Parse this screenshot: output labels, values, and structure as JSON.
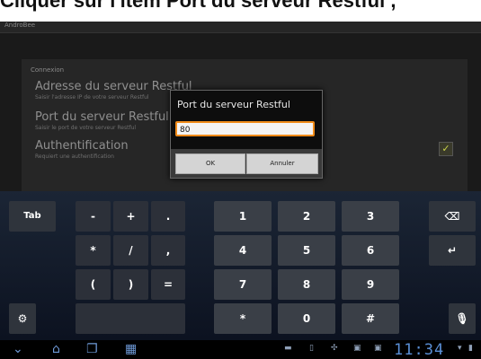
{
  "caption": "Cliquer sur l'item Port du serveur Restful ,",
  "app": {
    "title": "AndroBee"
  },
  "settings": {
    "section": "Connexion",
    "items": [
      {
        "title": "Adresse du serveur Restful",
        "summary": "Saisir l'adresse IP de votre serveur Restful"
      },
      {
        "title": "Port du serveur Restful",
        "summary": "Saisir le port de votre serveur Restful"
      },
      {
        "title": "Authentification",
        "summary": "Requiert une authentification",
        "checked": true
      }
    ]
  },
  "dialog": {
    "title": "Port du serveur Restful",
    "value": "80",
    "ok_label": "OK",
    "cancel_label": "Annuler"
  },
  "keyboard": {
    "tab": "Tab",
    "symbols": [
      "-",
      "+",
      ".",
      "*",
      "/",
      ",",
      "(",
      ")",
      "="
    ],
    "digits": [
      "1",
      "2",
      "3",
      "4",
      "5",
      "6",
      "7",
      "8",
      "9",
      "*",
      "0",
      "#"
    ]
  },
  "status": {
    "time": "11:34"
  },
  "colors": {
    "accent": "#f08b19",
    "clock": "#5a8fd6"
  }
}
